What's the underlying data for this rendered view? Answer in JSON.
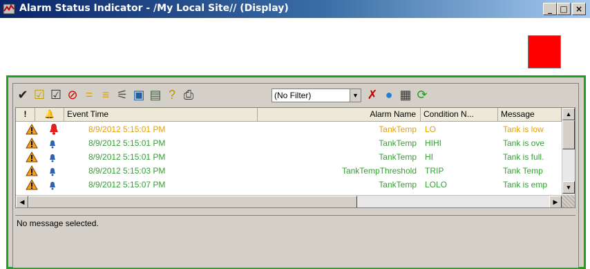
{
  "window": {
    "title": "Alarm Status Indicator - /My Local Site// (Display)",
    "buttons": {
      "minimize": "_",
      "maximize": "□",
      "close": "×"
    }
  },
  "status_indicator": {
    "color": "#ff0000"
  },
  "toolbar": {
    "icons": [
      "acknowledge-check-icon",
      "acknowledge-selected-icon",
      "acknowledge-all-icon",
      "disable-icon",
      "equals-icon",
      "sort-icon",
      "freeze-icon",
      "alarm-summary-icon",
      "properties-icon",
      "help-icon",
      "print-icon",
      "clear-filter-icon",
      "refresh-query-icon",
      "log-icon",
      "cycle-icon"
    ],
    "filter": {
      "selected": "(No Filter)"
    }
  },
  "grid": {
    "headers": {
      "alert": "!",
      "bell": "🔔",
      "time": "Event Time",
      "name": "Alarm Name",
      "cond": "Condition N...",
      "msg": "Message"
    },
    "rows": [
      {
        "time": "8/9/2012 5:15:01 PM",
        "name": "TankTemp",
        "cond": "LO",
        "msg": "Tank is low",
        "color": "#e8a000",
        "bell": "red"
      },
      {
        "time": "8/9/2012 5:15:01 PM",
        "name": "TankTemp",
        "cond": "HIHI",
        "msg": "Tank is ove",
        "color": "#33a033",
        "bell": "blue"
      },
      {
        "time": "8/9/2012 5:15:01 PM",
        "name": "TankTemp",
        "cond": "HI",
        "msg": "Tank is full.",
        "color": "#33a033",
        "bell": "blue"
      },
      {
        "time": "8/9/2012 5:15:03 PM",
        "name": "TankTempThreshold",
        "cond": "TRIP",
        "msg": "Tank Temp",
        "color": "#33a033",
        "bell": "blue"
      },
      {
        "time": "8/9/2012 5:15:07 PM",
        "name": "TankTemp",
        "cond": "LOLO",
        "msg": "Tank is emp",
        "color": "#33a033",
        "bell": "blue"
      }
    ]
  },
  "message_pane": {
    "text": "No message selected."
  }
}
